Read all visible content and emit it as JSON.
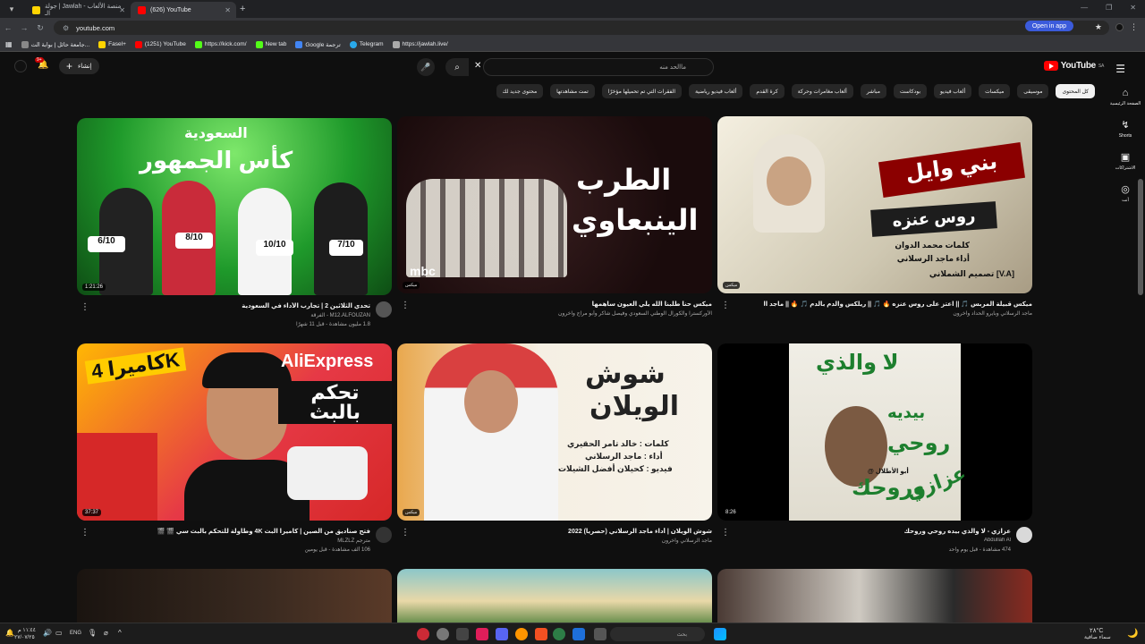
{
  "browser": {
    "tabs": [
      {
        "label": "جولة | Jawlah - منصة الألعاب الـ",
        "color": "#ffd400"
      },
      {
        "label": "(626) YouTube",
        "color": "#ff0000"
      }
    ],
    "url": "youtube.com",
    "open_in_app": "Open in app",
    "bookmarks": [
      "جامعة حائل | بوابة الت...",
      "Fasel+",
      "(1251) YouTube",
      "https://kick.com/",
      "New tab",
      "Google ترجمة",
      "Telegram",
      "https://jawlah.live/"
    ]
  },
  "youtube": {
    "logo": "YouTube",
    "logo_region": "SA",
    "search_placeholder": "ماالحد منه",
    "create_label": "إنشاء",
    "notif_count": "9+",
    "chips": [
      "كل المحتوى",
      "موسيقى",
      "ميكسات",
      "ألعاب فيديو",
      "بودكاست",
      "مباشر",
      "ألعاب مغامرات وحركة",
      "كرة القدم",
      "ألعاب فيديو رياضية",
      "الفقرات التي تم تحميلها مؤخرًا",
      "تمت مشاهدتها",
      "محتوى جديد لك"
    ],
    "sidebar": [
      {
        "label": "الصفحة الرئيسية",
        "icon": "home-icon"
      },
      {
        "label": "Shorts",
        "icon": "shorts-icon"
      },
      {
        "label": "الاشتراكات",
        "icon": "subscriptions-icon"
      },
      {
        "label": "أنت",
        "icon": "you-icon"
      }
    ]
  },
  "videos": [
    {
      "title": "ميكس قبيلة المربس 🎵 || اعتز على روس عنزه 🔥 🎵 || ريلكس والدم بالدم 🎵 🔥 || ماجد الرسلاني ♪ 2019",
      "channel": "ماجد الرسلاني وبايرو الحداد وآخرون",
      "stats": "",
      "badge": "ميكس",
      "thumb_text": [
        "بني وايل",
        "روس عنزه",
        "كلمات محمد الدوان",
        "أداء ماجد الرسلاني",
        "تصميم الشملاني [V.A]"
      ]
    },
    {
      "title": "ميكس حنا طلبنا الله يلي العيون ساهمها",
      "channel": "الأوركسترا والكورال الوطني السعودي وفيصل شاكر وأبو مراج وآخرون",
      "stats": "",
      "badge": "ميكس",
      "thumb_text": [
        "الطرب",
        "الينبعاوي",
        "mbc"
      ]
    },
    {
      "title": "تحدي الثلاثين 2 | تجارب الأداء في السعودية",
      "channel": "M12.ALFOUZAN - الفرقة",
      "stats": "1.8 مليون مشاهدة - قبل 11 شهرًا",
      "duration": "1:21:26",
      "thumb_text": [
        "السعودية",
        "كأس الجمهور",
        "6/10",
        "8/10",
        "10/10",
        "7/10"
      ]
    },
    {
      "title": "عزازي - لا والذي بيده روحي وروحك",
      "channel": "Abdullah Al",
      "stats": "474 مشاهدة - قبل يوم واحد",
      "duration": "8:26",
      "thumb_text": [
        "لا والذي",
        "بيديه",
        "روحي",
        "وروحك",
        "عزازي",
        "@ أبو الأطلال"
      ]
    },
    {
      "title": "شوش الويلان | أداء ماجد الرسلاني (حصريا) 2022",
      "channel": "ماجد الرسلاني وآخرون",
      "stats": "",
      "badge": "ميكس",
      "thumb_text": [
        "شوش",
        "الويلان",
        "كلمات : خالد تامر الحقيري",
        "أداء : ماجد الرسلاني",
        "فيديو : كحيلان أفضل الشيلات"
      ]
    },
    {
      "title": "فتح صناديق من الصين | كاميرا البث 4K وطاولة للتحكم بالبث سي 🎬 🎬",
      "channel": "مترجم MLZLZ",
      "stats": "106 ألف مشاهدة - قبل يومين",
      "duration": "37:37",
      "thumb_text": [
        "كاميرا 4K",
        "AliExpress",
        "تحكم بالبث"
      ]
    }
  ],
  "taskbar": {
    "lang": "ENG",
    "search": "بحث",
    "time": "١١:٤٤ م",
    "date": "٢٧/٠٧/٢٥",
    "weather": "٢٨°C",
    "weather_desc": "سماء صافية"
  },
  "colors": {
    "accent": "#ff0000",
    "background": "#0f0f0f",
    "chip_bg": "#272727"
  }
}
